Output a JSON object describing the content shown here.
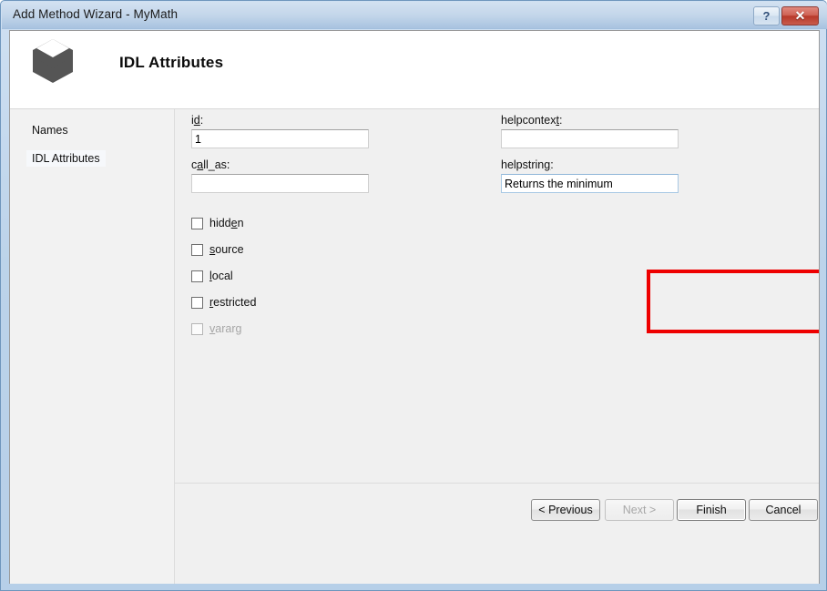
{
  "window": {
    "title": "Add Method Wizard - MyMath",
    "help_button_label": "?",
    "close_button_label": "✕"
  },
  "header": {
    "title": "IDL Attributes",
    "icon": "cube-icon"
  },
  "sidebar": {
    "items": [
      {
        "label": "Names",
        "selected": false
      },
      {
        "label": "IDL Attributes",
        "selected": true
      }
    ]
  },
  "form": {
    "id": {
      "label_pre": "i",
      "label_mnemonic": "d",
      "label_post": ":",
      "value": "1"
    },
    "call_as": {
      "label_pre": "c",
      "label_mnemonic": "a",
      "label_post": "ll_as:",
      "value": ""
    },
    "helpcontext": {
      "label_pre": "helpcontex",
      "label_mnemonic": "t",
      "label_post": ":",
      "value": ""
    },
    "helpstring": {
      "label_pre": "helpstrin",
      "label_mnemonic": "g",
      "label_post": ":",
      "value": "Returns the minimum",
      "focused": true
    },
    "checkboxes": [
      {
        "pre": "hidd",
        "mnemonic": "e",
        "post": "n",
        "checked": false,
        "disabled": false
      },
      {
        "pre": "",
        "mnemonic": "s",
        "post": "ource",
        "checked": false,
        "disabled": false
      },
      {
        "pre": "",
        "mnemonic": "l",
        "post": "ocal",
        "checked": false,
        "disabled": false
      },
      {
        "pre": "",
        "mnemonic": "r",
        "post": "estricted",
        "checked": false,
        "disabled": false
      },
      {
        "pre": "",
        "mnemonic": "v",
        "post": "ararg",
        "checked": false,
        "disabled": true
      }
    ]
  },
  "footer": {
    "previous_label": "< Previous",
    "next_label": "Next >",
    "finish_label": "Finish",
    "cancel_label": "Cancel"
  },
  "annotation": {
    "color": "#ee0000",
    "target": "helpstring-field"
  }
}
